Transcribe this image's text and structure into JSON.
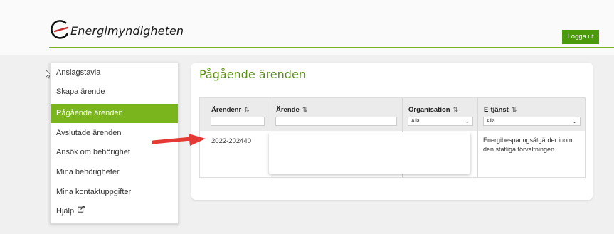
{
  "header": {
    "logo_text": "Energimyndigheten",
    "logout_label": "Logga ut"
  },
  "colors": {
    "accent_green": "#7ab51d",
    "logout_green": "#4a9a0c",
    "title_green": "#5a8f16",
    "arrow_red": "#e53935"
  },
  "sidebar": {
    "items": [
      {
        "label": "Anslagstavla",
        "active": false
      },
      {
        "label": "Skapa ärende",
        "active": false
      },
      {
        "label": "Pågående ärenden",
        "active": true
      },
      {
        "label": "Avslutade ärenden",
        "active": false
      },
      {
        "label": "Ansök om behörighet",
        "active": false
      },
      {
        "label": "Mina behörigheter",
        "active": false
      },
      {
        "label": "Mina kontaktuppgifter",
        "active": false
      },
      {
        "label": "Hjälp",
        "active": false,
        "icon": "external-link-icon"
      }
    ]
  },
  "main": {
    "title": "Pågående ärenden",
    "table": {
      "columns": [
        {
          "label": "Ärendenr",
          "filter": "text",
          "value": ""
        },
        {
          "label": "Ärende",
          "filter": "text",
          "value": ""
        },
        {
          "label": "Organisation",
          "filter": "select",
          "value": "Alla"
        },
        {
          "label": "E-tjänst",
          "filter": "select",
          "value": "Alla"
        }
      ],
      "rows": [
        {
          "arendenr": "2022-202440",
          "arende": "",
          "organisation": "",
          "etjanst_line1": "Energibesparingsåtgärder inom",
          "etjanst_line2": "den statliga förvaltningen"
        }
      ]
    }
  }
}
